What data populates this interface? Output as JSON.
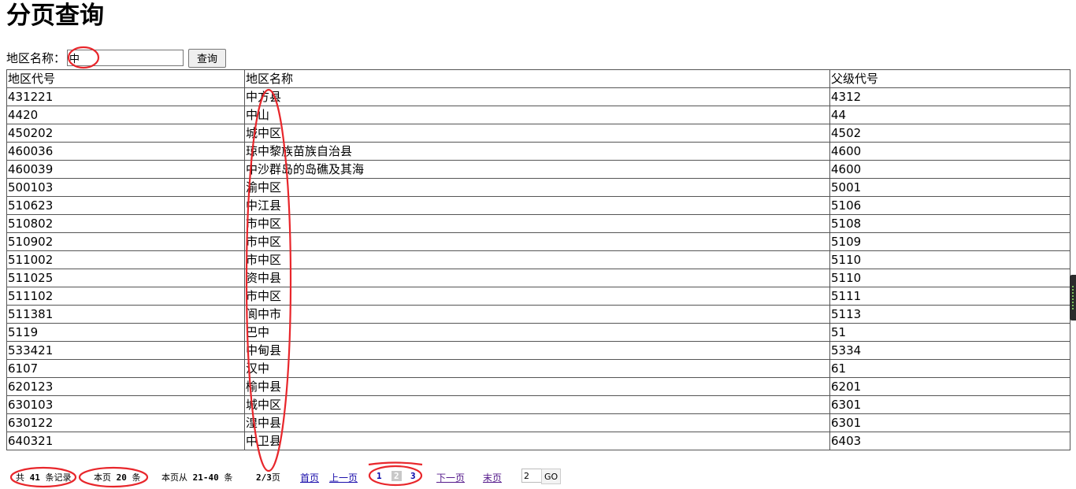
{
  "page_title": "分页查询",
  "search": {
    "label": "地区名称：",
    "value": "中",
    "button_label": "查询"
  },
  "table": {
    "headers": [
      "地区代号",
      "地区名称",
      "父级代号"
    ],
    "rows": [
      [
        "431221",
        "中方县",
        "4312"
      ],
      [
        "4420",
        "中山",
        "44"
      ],
      [
        "450202",
        "城中区",
        "4502"
      ],
      [
        "460036",
        "琼中黎族苗族自治县",
        "4600"
      ],
      [
        "460039",
        "中沙群岛的岛礁及其海",
        "4600"
      ],
      [
        "500103",
        "渝中区",
        "5001"
      ],
      [
        "510623",
        "中江县",
        "5106"
      ],
      [
        "510802",
        "市中区",
        "5108"
      ],
      [
        "510902",
        "市中区",
        "5109"
      ],
      [
        "511002",
        "市中区",
        "5110"
      ],
      [
        "511025",
        "资中县",
        "5110"
      ],
      [
        "511102",
        "市中区",
        "5111"
      ],
      [
        "511381",
        "阆中市",
        "5113"
      ],
      [
        "5119",
        "巴中",
        "51"
      ],
      [
        "533421",
        "中甸县",
        "5334"
      ],
      [
        "6107",
        "汉中",
        "61"
      ],
      [
        "620123",
        "榆中县",
        "6201"
      ],
      [
        "630103",
        "城中区",
        "6301"
      ],
      [
        "630122",
        "湟中县",
        "6301"
      ],
      [
        "640321",
        "中卫县",
        "6403"
      ]
    ]
  },
  "pager": {
    "total_prefix": "共",
    "total_count": "41",
    "total_suffix": "条记录",
    "page_size_prefix": "本页",
    "page_size": "20",
    "page_size_suffix": "条",
    "range_prefix": "本页从",
    "range": "21-40",
    "range_suffix": "条",
    "page_of": "2/3",
    "page_of_suffix": "页",
    "first_label": "首页",
    "prev_label": "上一页",
    "pages": [
      "1",
      "2",
      "3"
    ],
    "next_label": "下一页",
    "last_label": "末页",
    "goto_value": "2",
    "go_label": "GO"
  },
  "colors": {
    "annotation": "#e8262b",
    "link": "#1a0dab",
    "visited_link": "#551a8b",
    "current_page_bg": "#c8c8c8"
  }
}
